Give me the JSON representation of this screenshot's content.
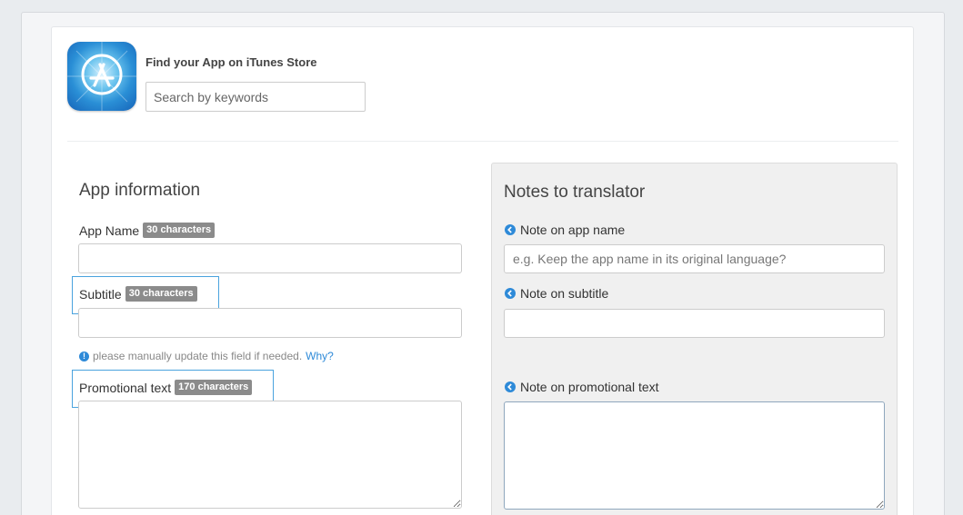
{
  "store_search": {
    "title": "Find your App on iTunes Store",
    "placeholder": "Search by keywords",
    "icon": "app-store-icon"
  },
  "app_info": {
    "title": "App information",
    "app_name": {
      "label": "App Name",
      "badge": "30 characters",
      "value": ""
    },
    "subtitle": {
      "label": "Subtitle",
      "badge": "30 characters",
      "value": ""
    },
    "hint": {
      "text": "please manually update this field if needed.",
      "link": "Why?"
    },
    "promotional_text": {
      "label": "Promotional text",
      "badge": "170 characters",
      "value": ""
    }
  },
  "notes": {
    "title": "Notes to translator",
    "app_name": {
      "label": "Note on app name",
      "placeholder": "e.g. Keep the app name in its original language?"
    },
    "subtitle": {
      "label": "Note on subtitle",
      "placeholder": ""
    },
    "promotional_text": {
      "label": "Note on promotional text",
      "placeholder": ""
    }
  },
  "colors": {
    "accent": "#2e8ad8",
    "badge": "#8b8b8b",
    "highlight": "#4aa3de",
    "panel": "#f0f0f0"
  }
}
